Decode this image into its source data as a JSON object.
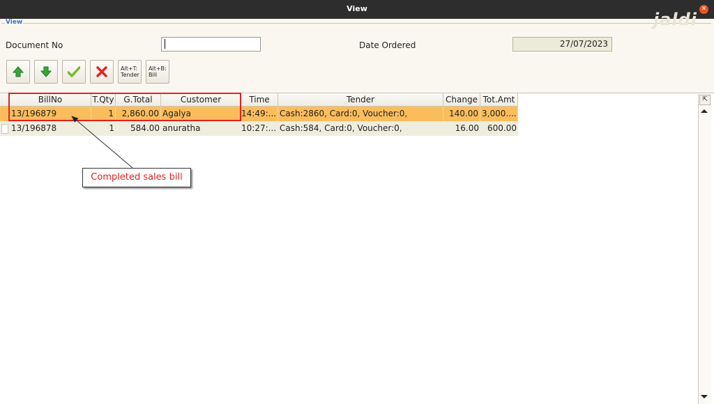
{
  "window": {
    "title": "View",
    "close_icon": "close-icon"
  },
  "panel": {
    "legend": "View",
    "watermark": "Jaldi",
    "document_no_label": "Document No",
    "document_no_value": "",
    "date_ordered_label": "Date Ordered",
    "date_ordered_value": "27/07/2023"
  },
  "toolbar": {
    "up_icon": "arrow-up-icon",
    "down_icon": "arrow-down-icon",
    "accept_icon": "check-icon",
    "cancel_icon": "x-icon",
    "tender_label_1": "Alt+T:",
    "tender_label_2": "Tender",
    "bill_label_1": "Alt+B:",
    "bill_label_2": "Bill"
  },
  "table": {
    "columns": [
      "BillNo",
      "T.Qty",
      "G.Total",
      "Customer",
      "Time",
      "Tender",
      "Change",
      "Tot.Amt"
    ],
    "rows": [
      [
        "13/196879",
        "1",
        "2,860.00",
        "Agalya",
        "14:49:...",
        "Cash:2860, Card:0, Voucher:0,",
        "140.00",
        "3,000...."
      ],
      [
        "13/196878",
        "1",
        "584.00",
        "anuratha",
        "10:27:...",
        "Cash:584, Card:0, Voucher:0,",
        "16.00",
        "600.00"
      ]
    ],
    "selected_row": 0
  },
  "annotation": {
    "callout": "Completed sales bill"
  },
  "colors": {
    "titlebar": "#2d2d2d",
    "close": "#e9541f",
    "selected_row": "#fbbd5c",
    "alt_row": "#efedde",
    "highlight": "#e02020",
    "legend": "#3a74c4"
  }
}
